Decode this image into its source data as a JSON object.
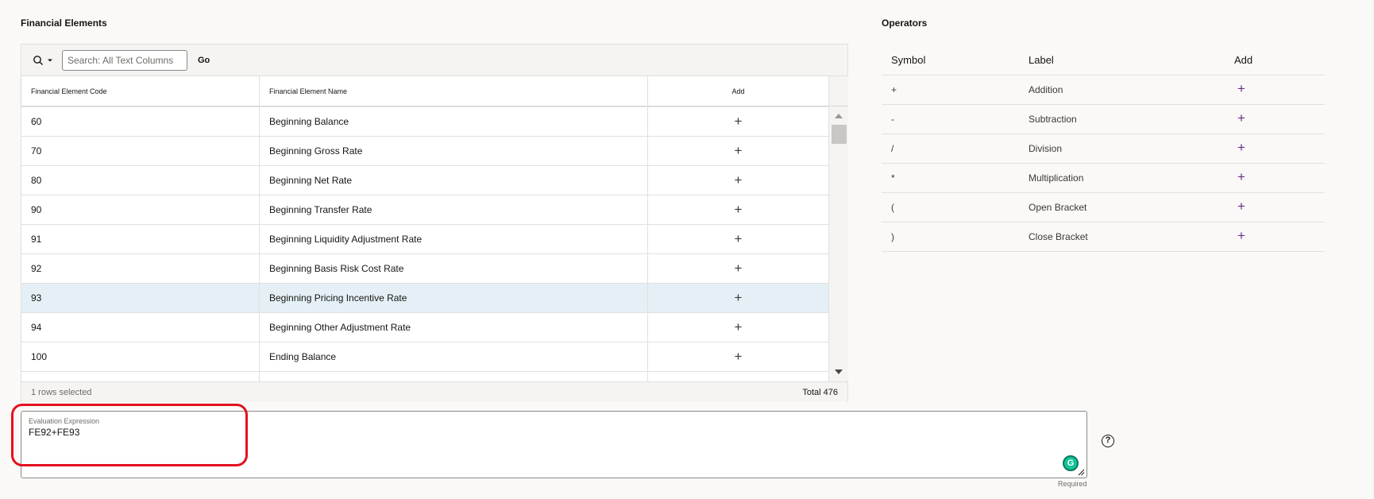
{
  "financial_elements": {
    "title": "Financial Elements",
    "search": {
      "placeholder": "Search: All Text Columns",
      "value": "",
      "go_label": "Go"
    },
    "columns": [
      "Financial Element Code",
      "Financial Element Name",
      "Add"
    ],
    "rows": [
      {
        "code": "60",
        "name": "Beginning Balance",
        "selected": false
      },
      {
        "code": "70",
        "name": "Beginning Gross Rate",
        "selected": false
      },
      {
        "code": "80",
        "name": "Beginning Net Rate",
        "selected": false
      },
      {
        "code": "90",
        "name": "Beginning Transfer Rate",
        "selected": false
      },
      {
        "code": "91",
        "name": "Beginning Liquidity Adjustment Rate",
        "selected": false
      },
      {
        "code": "92",
        "name": "Beginning Basis Risk Cost Rate",
        "selected": false
      },
      {
        "code": "93",
        "name": "Beginning Pricing Incentive Rate",
        "selected": true
      },
      {
        "code": "94",
        "name": "Beginning Other Adjustment Rate",
        "selected": false
      },
      {
        "code": "100",
        "name": "Ending Balance",
        "selected": false
      }
    ],
    "add_symbol": "+",
    "rows_selected": "1 rows selected",
    "total": "Total 476"
  },
  "operators": {
    "title": "Operators",
    "columns": [
      "Symbol",
      "Label",
      "Add"
    ],
    "rows": [
      {
        "symbol": "+",
        "label": "Addition"
      },
      {
        "symbol": "-",
        "label": "Subtraction"
      },
      {
        "symbol": "/",
        "label": "Division"
      },
      {
        "symbol": "*",
        "label": "Multiplication"
      },
      {
        "symbol": "(",
        "label": "Open Bracket"
      },
      {
        "symbol": ")",
        "label": "Close Bracket"
      }
    ],
    "add_symbol": "+",
    "accent_color": "#6b2d86"
  },
  "expression": {
    "label": "Evaluation Expression",
    "value": "FE92+FE93",
    "required_label": "Required",
    "help_symbol": "?",
    "grammarly_letter": "G"
  },
  "colors": {
    "selected_row": "#e4f0f5",
    "annotation": "#e4101f"
  }
}
